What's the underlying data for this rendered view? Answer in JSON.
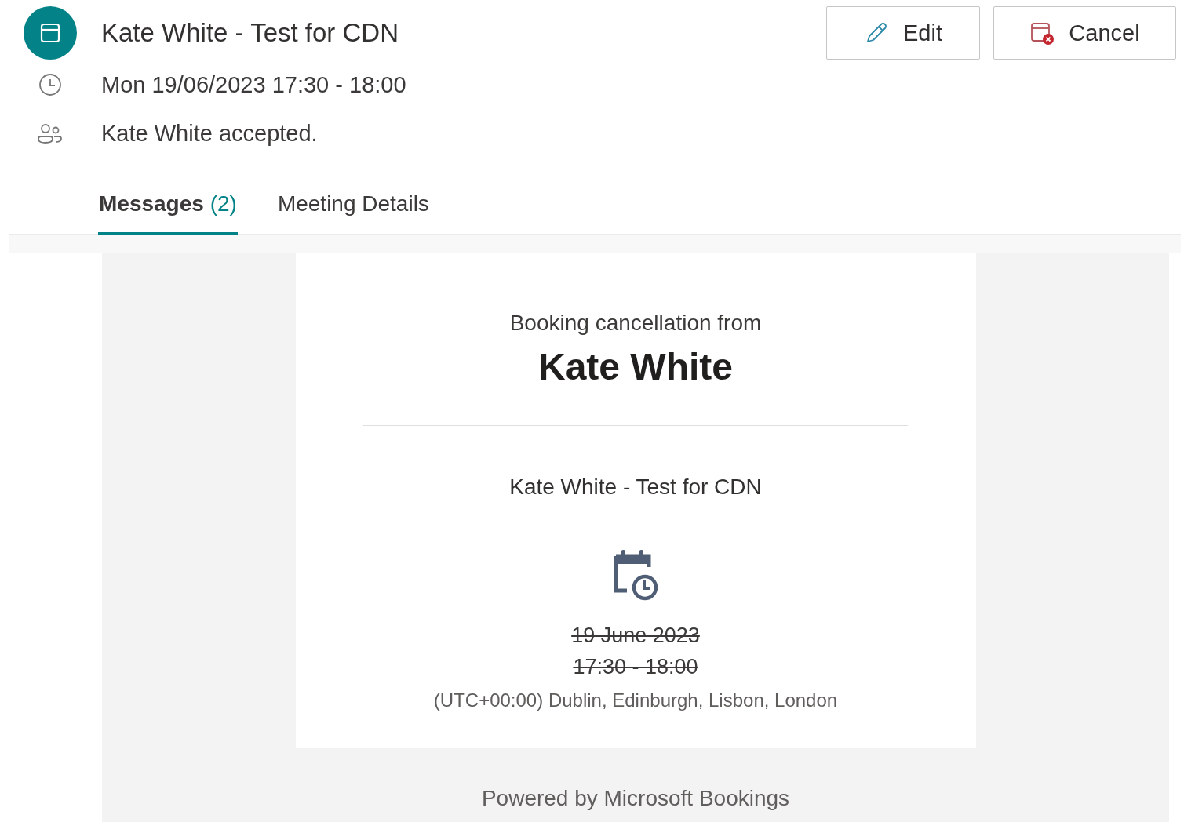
{
  "header": {
    "title": "Kate White - Test for CDN",
    "when": "Mon 19/06/2023 17:30 - 18:00",
    "attendees": "Kate White accepted."
  },
  "actions": [
    {
      "kind": "edit",
      "label": "Edit"
    },
    {
      "kind": "cancel",
      "label": "Cancel"
    }
  ],
  "tabs": [
    {
      "label": "Messages",
      "count": "(2)",
      "selected": true
    },
    {
      "label": "Meeting Details",
      "selected": false
    }
  ],
  "message": {
    "heading": "Booking cancellation from",
    "name": "Kate White",
    "service": "Kate White - Test for CDN",
    "date": "19 June 2023",
    "time": "17:30 - 18:00",
    "cancelled": true,
    "timezone": "(UTC+00:00) Dublin, Edinburgh, Lisbon, London",
    "footer": "Powered by Microsoft Bookings"
  }
}
